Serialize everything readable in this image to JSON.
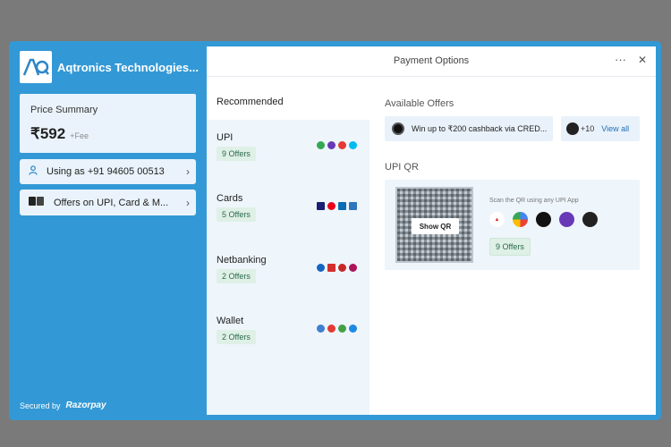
{
  "merchant": {
    "name": "Aqtronics Technologies..."
  },
  "price_summary": {
    "label": "Price Summary",
    "amount": "₹592",
    "fee": "+Fee"
  },
  "user": {
    "label": "Using as +91 94605 00513"
  },
  "offers_pill": {
    "label": "Offers on UPI, Card & M..."
  },
  "footer": {
    "secured_by": "Secured by",
    "brand": "Razorpay"
  },
  "header": {
    "title": "Payment Options",
    "more_icon": "more-horizontal-icon",
    "close_icon": "close-icon"
  },
  "methods": {
    "heading": "Recommended",
    "items": [
      {
        "name": "UPI",
        "badge": "9 Offers"
      },
      {
        "name": "Cards",
        "badge": "5 Offers"
      },
      {
        "name": "Netbanking",
        "badge": "2 Offers"
      },
      {
        "name": "Wallet",
        "badge": "2 Offers"
      }
    ]
  },
  "available_offers": {
    "heading": "Available Offers",
    "offer_text": "Win up to ₹200 cashback via CRED...",
    "more_count": "+10",
    "view_all": "View all"
  },
  "upi_qr": {
    "heading": "UPI QR",
    "show_qr": "Show QR",
    "scan_text": "Scan the QR using any UPI App",
    "badge": "9 Offers"
  },
  "colors": {
    "brand": "#3399d6",
    "panel": "#eaf3fb",
    "badge_bg": "#dff0e6",
    "link": "#1f6fb8"
  }
}
